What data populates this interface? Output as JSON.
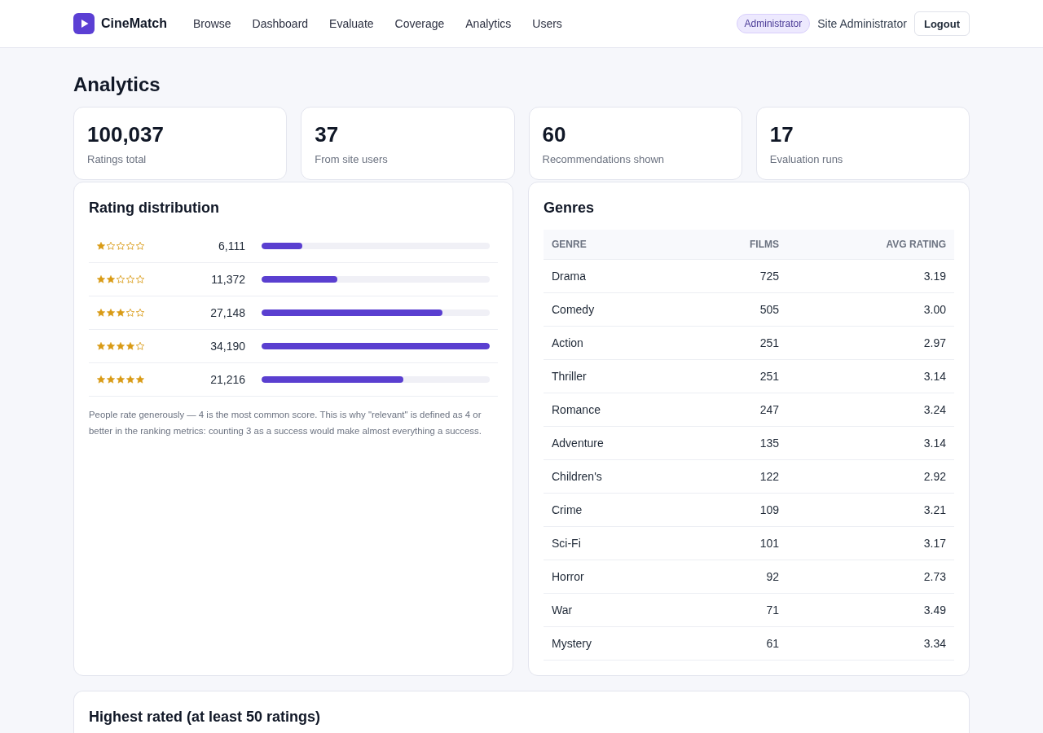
{
  "header": {
    "brand": "CineMatch",
    "nav": [
      {
        "label": "Browse"
      },
      {
        "label": "Dashboard"
      },
      {
        "label": "Evaluate"
      },
      {
        "label": "Coverage"
      },
      {
        "label": "Analytics"
      },
      {
        "label": "Users"
      }
    ],
    "role_badge": "Administrator",
    "user_name": "Site Administrator",
    "logout": "Logout"
  },
  "page_title": "Analytics",
  "stats": [
    {
      "value": "100,037",
      "label": "Ratings total"
    },
    {
      "value": "37",
      "label": "From site users"
    },
    {
      "value": "60",
      "label": "Recommendations shown"
    },
    {
      "value": "17",
      "label": "Evaluation runs"
    }
  ],
  "rating_distribution": {
    "title": "Rating distribution",
    "rows": [
      {
        "stars": 1,
        "count": "6,111",
        "level": 0.179
      },
      {
        "stars": 2,
        "count": "11,372",
        "level": 0.333
      },
      {
        "stars": 3,
        "count": "27,148",
        "level": 0.794
      },
      {
        "stars": 4,
        "count": "34,190",
        "level": 1
      },
      {
        "stars": 5,
        "count": "21,216",
        "level": 0.621
      }
    ],
    "note": "People rate generously — 4 is the most common score. This is why \"relevant\" is defined as 4 or better in the ranking metrics: counting 3 as a success would make almost everything a success."
  },
  "genres": {
    "title": "Genres",
    "columns": [
      "GENRE",
      "FILMS",
      "AVG RATING"
    ],
    "rows": [
      {
        "genre": "Drama",
        "films": "725",
        "avg_rating": "3.19"
      },
      {
        "genre": "Comedy",
        "films": "505",
        "avg_rating": "3.00"
      },
      {
        "genre": "Action",
        "films": "251",
        "avg_rating": "2.97"
      },
      {
        "genre": "Thriller",
        "films": "251",
        "avg_rating": "3.14"
      },
      {
        "genre": "Romance",
        "films": "247",
        "avg_rating": "3.24"
      },
      {
        "genre": "Adventure",
        "films": "135",
        "avg_rating": "3.14"
      },
      {
        "genre": "Children's",
        "films": "122",
        "avg_rating": "2.92"
      },
      {
        "genre": "Crime",
        "films": "109",
        "avg_rating": "3.21"
      },
      {
        "genre": "Sci-Fi",
        "films": "101",
        "avg_rating": "3.17"
      },
      {
        "genre": "Horror",
        "films": "92",
        "avg_rating": "2.73"
      },
      {
        "genre": "War",
        "films": "71",
        "avg_rating": "3.49"
      },
      {
        "genre": "Mystery",
        "films": "61",
        "avg_rating": "3.34"
      }
    ]
  },
  "highest_rated": {
    "title": "Highest rated (at least 50 ratings)"
  }
}
